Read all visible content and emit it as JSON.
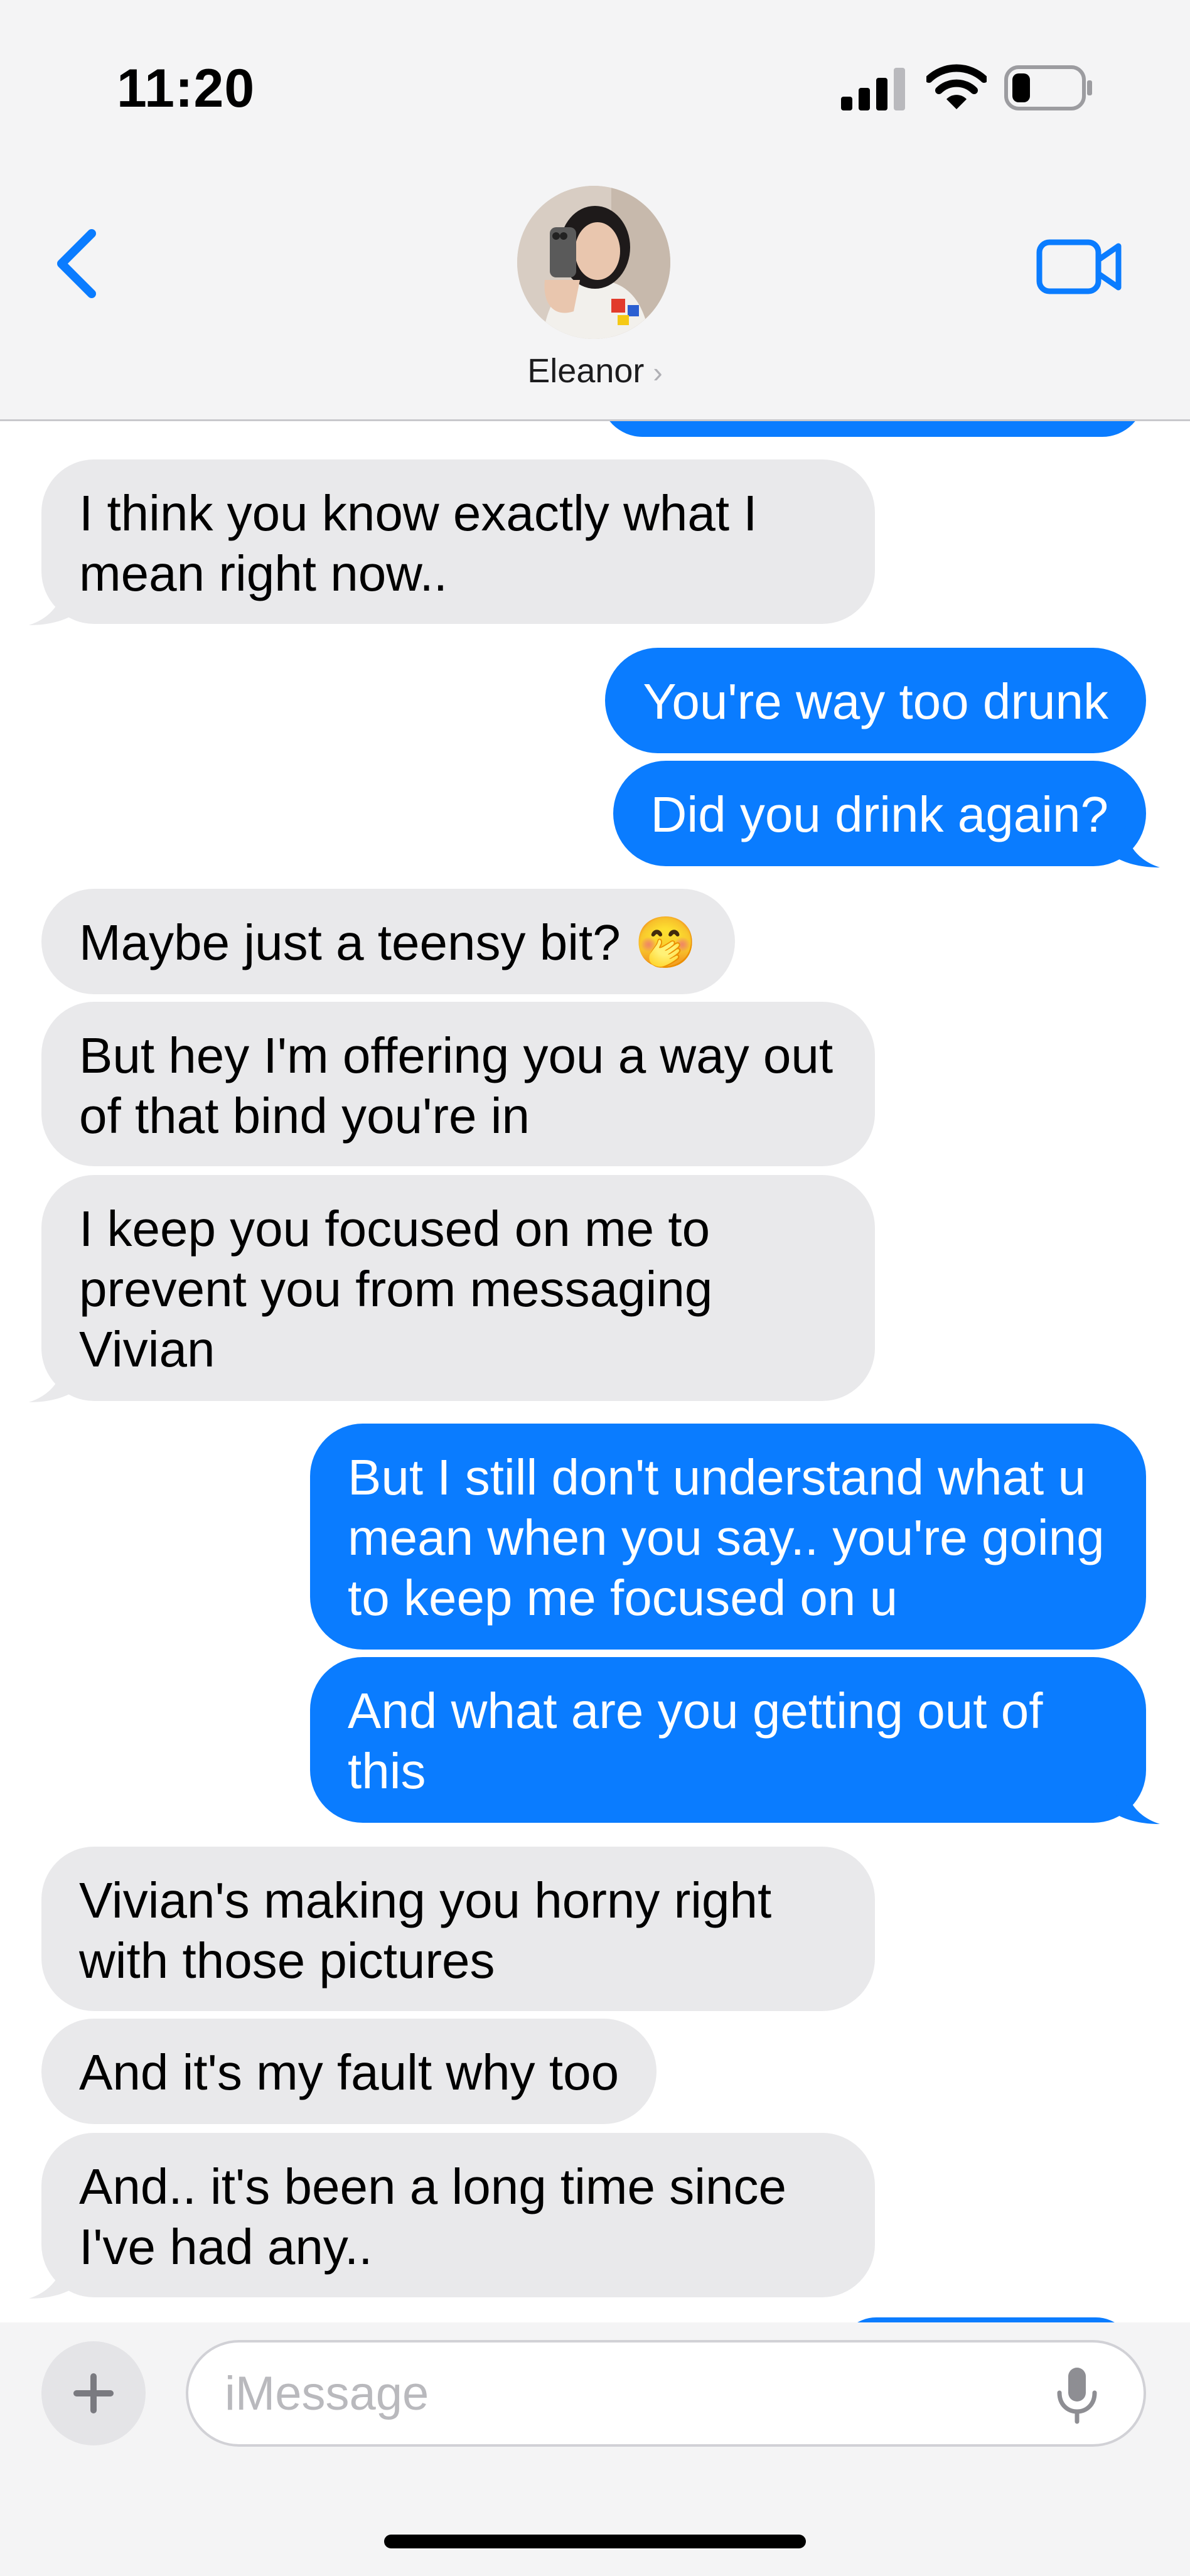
{
  "status_bar": {
    "time": "11:20"
  },
  "header": {
    "contact_name": "Eleanor",
    "name_chevron": "›"
  },
  "icons": {
    "back": "chevron-left-icon",
    "video": "video-camera-icon",
    "plus": "plus-icon",
    "mic": "microphone-icon",
    "signal": "cellular-signal-icon",
    "wifi": "wifi-icon",
    "battery": "battery-icon"
  },
  "colors": {
    "outgoing_bubble": "#0a7cff",
    "incoming_bubble": "#e9e9eb",
    "accent": "#0a7cff",
    "header_bg": "#f4f4f5"
  },
  "messages": [
    {
      "from": "them",
      "text": "I think you know exactly what I mean right now.."
    },
    {
      "from": "me",
      "text": "You're way too drunk"
    },
    {
      "from": "me",
      "text": "Did you drink again?"
    },
    {
      "from": "them",
      "text": "Maybe just a teensy bit? 🤭"
    },
    {
      "from": "them",
      "text": "But hey I'm offering you a way out of that bind you're in"
    },
    {
      "from": "them",
      "text": "I keep you focused on me to prevent you from messaging Vivian"
    },
    {
      "from": "me",
      "text": "But I still don't understand what u mean when you say.. you're going to keep me focused on u"
    },
    {
      "from": "me",
      "text": "And what are you getting out of this"
    },
    {
      "from": "them",
      "text": "Vivian's making you horny right with those pictures"
    },
    {
      "from": "them",
      "text": "And it's my fault why too"
    },
    {
      "from": "them",
      "text": "And.. it's been a long time since I've had any.."
    }
  ],
  "composer": {
    "placeholder": "iMessage"
  }
}
